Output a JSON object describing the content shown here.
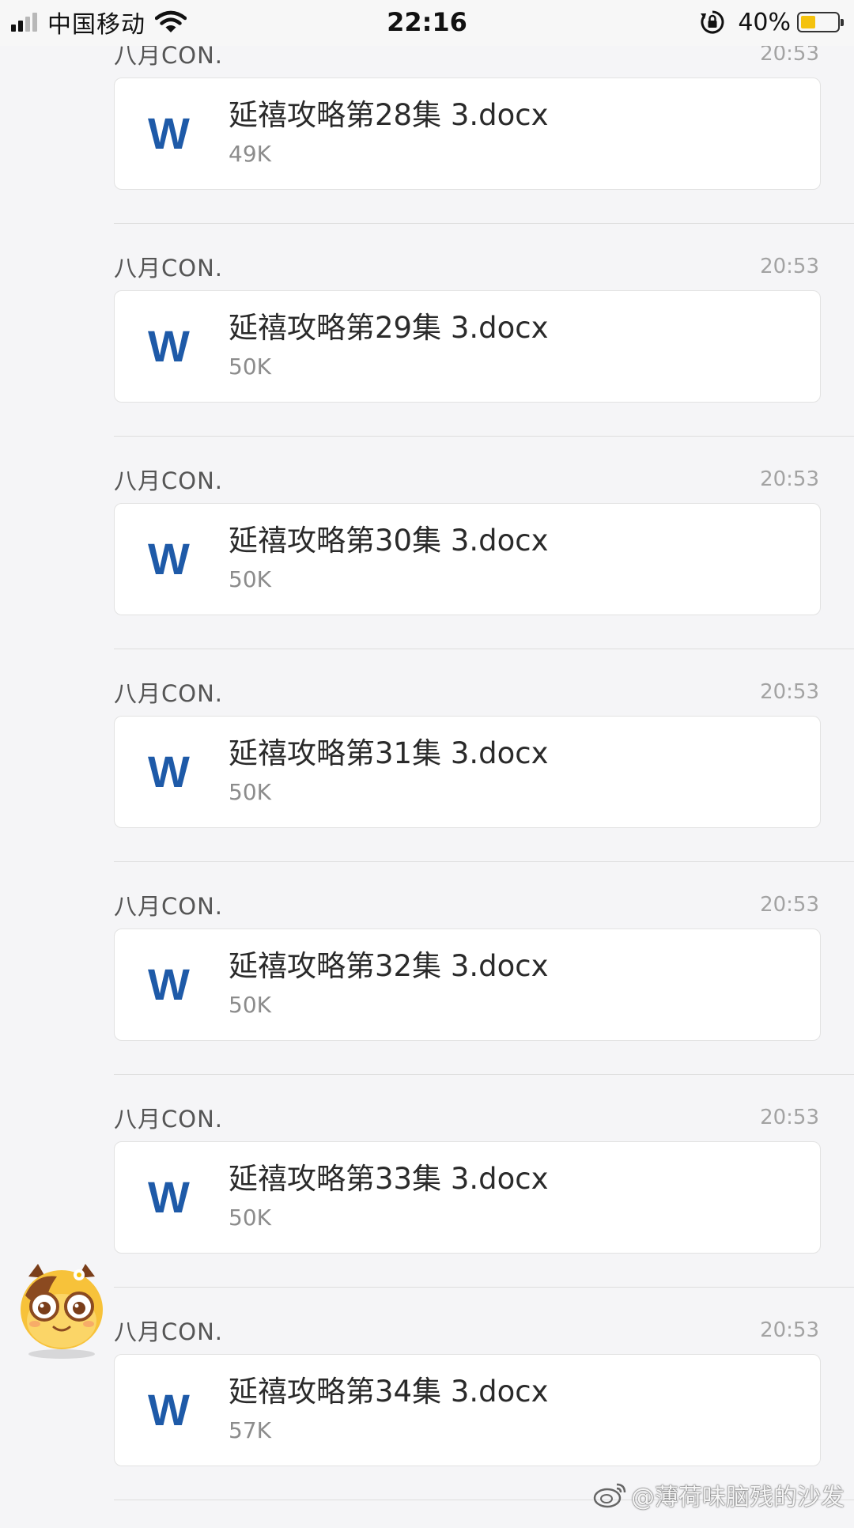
{
  "status_bar": {
    "carrier": "中国移动",
    "time": "22:16",
    "battery_percent": "40%",
    "battery_level": 0.4,
    "battery_color": "#f4c20d",
    "signal_bars": 2,
    "icons": [
      "signal-icon",
      "wifi-icon",
      "rotation-lock-icon",
      "battery-icon"
    ]
  },
  "messages": [
    {
      "sender": "八月CON.",
      "time": "20:53",
      "file_name": "延禧攻略第28集 3.docx",
      "file_size": "49K",
      "icon": "word-doc-icon",
      "icon_letter": "W"
    },
    {
      "sender": "八月CON.",
      "time": "20:53",
      "file_name": "延禧攻略第29集 3.docx",
      "file_size": "50K",
      "icon": "word-doc-icon",
      "icon_letter": "W"
    },
    {
      "sender": "八月CON.",
      "time": "20:53",
      "file_name": "延禧攻略第30集 3.docx",
      "file_size": "50K",
      "icon": "word-doc-icon",
      "icon_letter": "W"
    },
    {
      "sender": "八月CON.",
      "time": "20:53",
      "file_name": "延禧攻略第31集 3.docx",
      "file_size": "50K",
      "icon": "word-doc-icon",
      "icon_letter": "W"
    },
    {
      "sender": "八月CON.",
      "time": "20:53",
      "file_name": "延禧攻略第32集 3.docx",
      "file_size": "50K",
      "icon": "word-doc-icon",
      "icon_letter": "W"
    },
    {
      "sender": "八月CON.",
      "time": "20:53",
      "file_name": "延禧攻略第33集 3.docx",
      "file_size": "50K",
      "icon": "word-doc-icon",
      "icon_letter": "W"
    },
    {
      "sender": "八月CON.",
      "time": "20:53",
      "file_name": "延禧攻略第34集 3.docx",
      "file_size": "57K",
      "icon": "word-doc-icon",
      "icon_letter": "W"
    }
  ],
  "colors": {
    "background": "#f5f5f7",
    "word_blue": "#1e5aa8",
    "card": "#ffffff"
  },
  "watermark": {
    "text": "@薄荷味脑残的沙发",
    "icon": "weibo-icon"
  },
  "mascot": {
    "icon": "cow-mascot-icon"
  }
}
